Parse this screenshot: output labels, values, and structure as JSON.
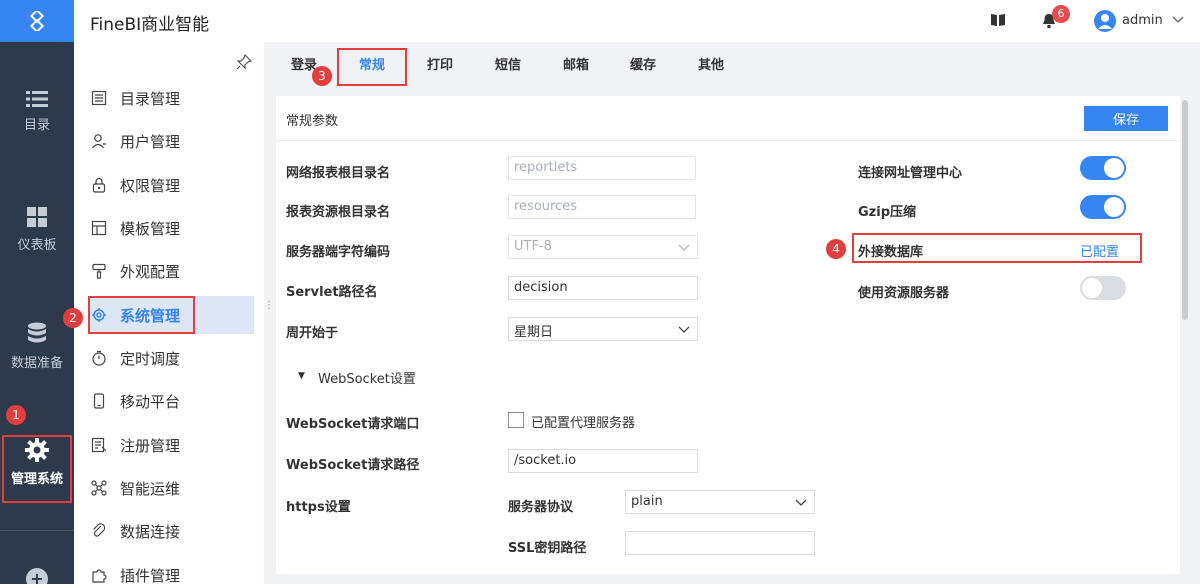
{
  "header": {
    "title": "FineBI商业智能",
    "notification_count": "6",
    "user_name": "admin"
  },
  "rail": {
    "items": [
      {
        "label": "目录",
        "icon": "list-icon"
      },
      {
        "label": "仪表板",
        "icon": "dashboard-icon"
      },
      {
        "label": "数据准备",
        "icon": "database-icon"
      },
      {
        "label": "管理系统",
        "icon": "gear-icon"
      }
    ]
  },
  "sidebar": {
    "items": [
      {
        "label": "目录管理",
        "icon": "catalog-icon"
      },
      {
        "label": "用户管理",
        "icon": "user-icon"
      },
      {
        "label": "权限管理",
        "icon": "lock-icon"
      },
      {
        "label": "模板管理",
        "icon": "template-icon"
      },
      {
        "label": "外观配置",
        "icon": "brush-icon"
      },
      {
        "label": "系统管理",
        "icon": "gear-icon"
      },
      {
        "label": "定时调度",
        "icon": "timer-icon"
      },
      {
        "label": "移动平台",
        "icon": "mobile-icon"
      },
      {
        "label": "注册管理",
        "icon": "register-icon"
      },
      {
        "label": "智能运维",
        "icon": "nodes-icon"
      },
      {
        "label": "数据连接",
        "icon": "link-icon"
      },
      {
        "label": "插件管理",
        "icon": "puzzle-icon"
      }
    ]
  },
  "tabs": [
    "登录",
    "常规",
    "打印",
    "短信",
    "邮箱",
    "缓存",
    "其他"
  ],
  "card": {
    "title": "常规参数",
    "save_label": "保存",
    "fields": {
      "web_root_label": "网络报表根目录名",
      "web_root_placeholder": "reportlets",
      "resource_root_label": "报表资源根目录名",
      "resource_root_placeholder": "resources",
      "charset_label": "服务器端字符编码",
      "charset_value": "UTF-8",
      "servlet_label": "Servlet路径名",
      "servlet_value": "decision",
      "week_start_label": "周开始于",
      "week_start_value": "星期日",
      "websocket_section": "WebSocket设置",
      "ws_port_label": "WebSocket请求端口",
      "ws_proxy_label": "已配置代理服务器",
      "ws_path_label": "WebSocket请求路径",
      "ws_path_value": "/socket.io",
      "https_label": "https设置",
      "protocol_label": "服务器协议",
      "protocol_value": "plain",
      "ssl_label": "SSL密钥路径",
      "url_center_label": "连接网址管理中心",
      "gzip_label": "Gzip压缩",
      "external_db_label": "外接数据库",
      "external_db_status": "已配置",
      "resource_server_label": "使用资源服务器"
    },
    "toggles": {
      "url_center": true,
      "gzip": true,
      "resource_server": false
    }
  },
  "annotations": [
    "1",
    "2",
    "3",
    "4"
  ]
}
